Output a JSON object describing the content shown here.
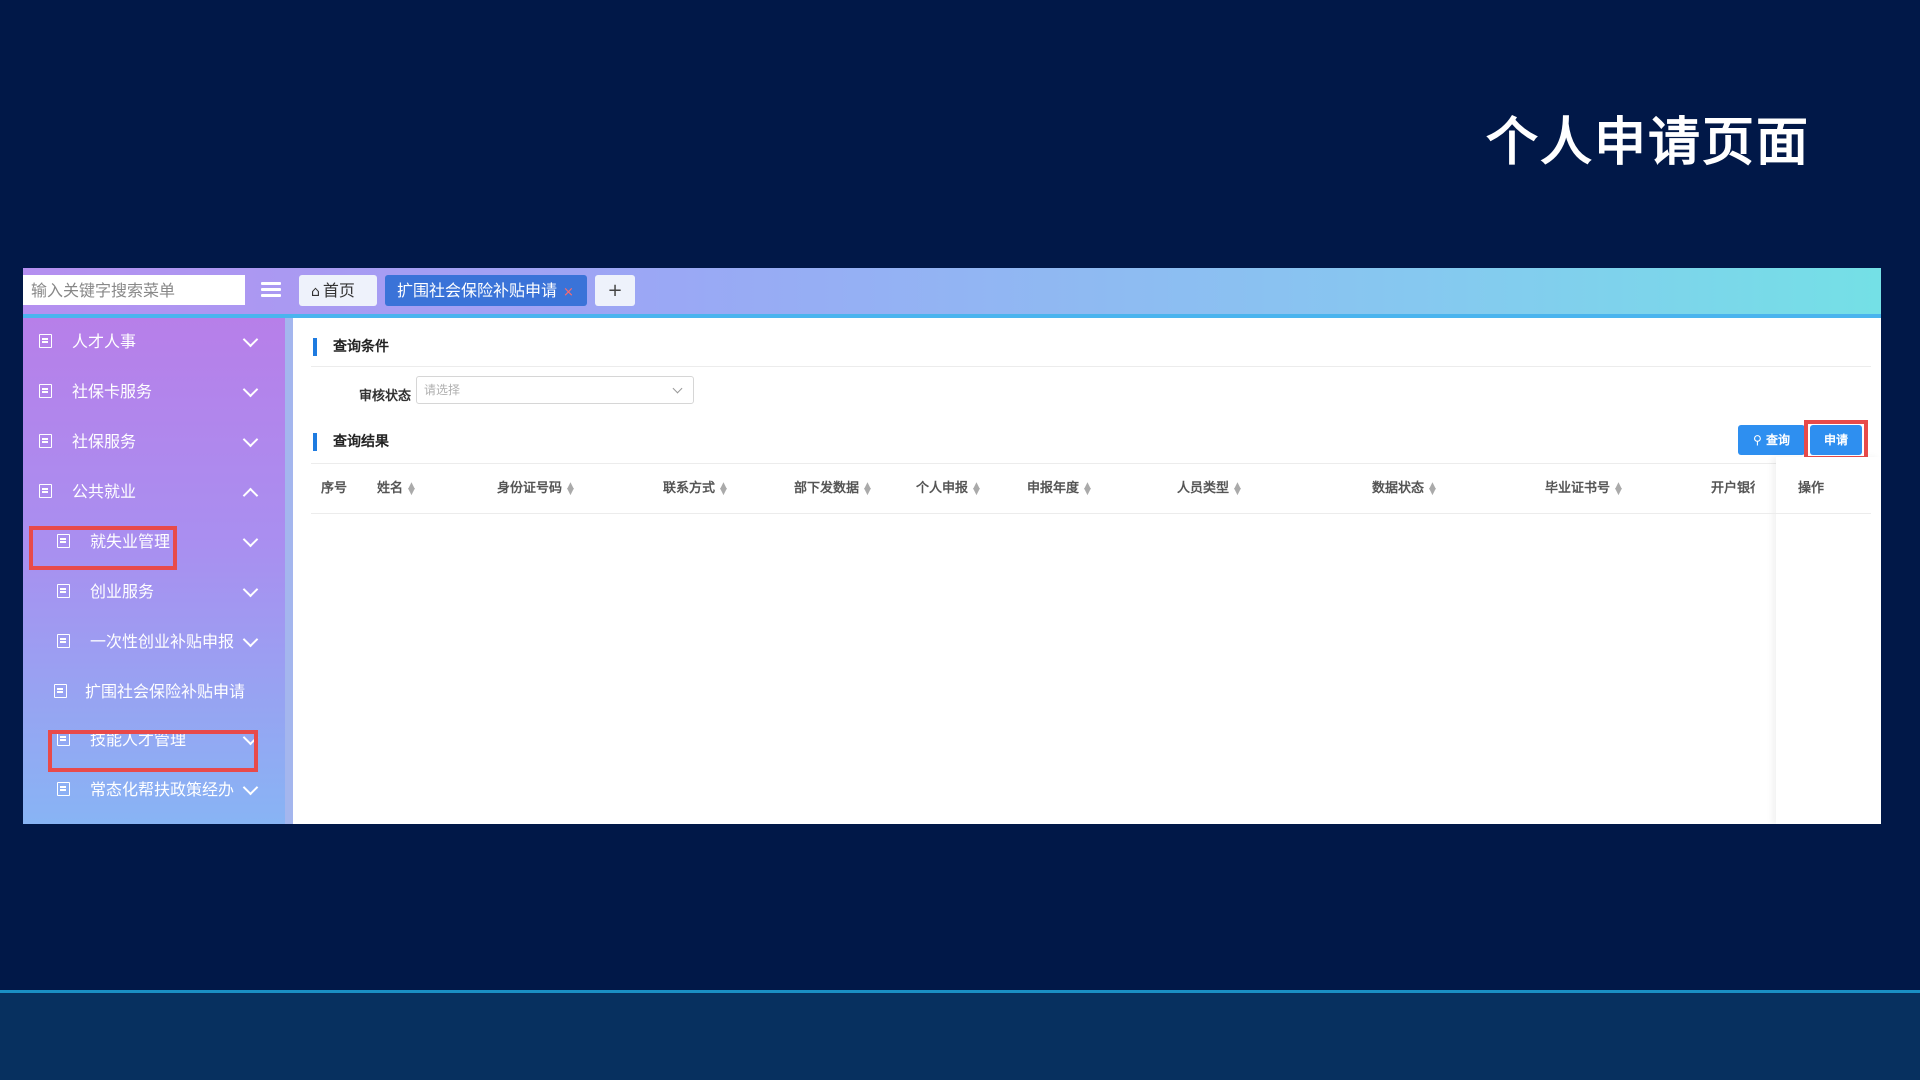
{
  "slide": {
    "title": "个人申请页面"
  },
  "topbar": {
    "search_placeholder": "输入关键字搜索菜单",
    "tabs": [
      {
        "label": "首页"
      },
      {
        "label": "扩围社会保险补贴申请",
        "close": "×"
      },
      {
        "label": "+"
      }
    ]
  },
  "sidebar": {
    "items": [
      {
        "label": "人才人事"
      },
      {
        "label": "社保卡服务"
      },
      {
        "label": "社保服务"
      },
      {
        "label": "公共就业"
      },
      {
        "label": "就失业管理"
      },
      {
        "label": "创业服务"
      },
      {
        "label": "一次性创业补贴申报"
      },
      {
        "label": "扩围社会保险补贴申请"
      },
      {
        "label": "技能人才管理"
      },
      {
        "label": "常态化帮扶政策经办"
      }
    ]
  },
  "main": {
    "query_section": "查询条件",
    "filter_label": "审核状态",
    "filter_placeholder": "请选择",
    "result_section": "查询结果",
    "query_button": "查询",
    "apply_button": "申请",
    "columns": [
      "序号",
      "姓名",
      "身份证号码",
      "联系方式",
      "部下发数据",
      "个人申报",
      "申报年度",
      "人员类型",
      "数据状态",
      "毕业证书号",
      "开户银行",
      "操作"
    ]
  },
  "colors": {
    "background": "#011848",
    "highlight": "#e84a4a",
    "accent": "#2e8ff0"
  }
}
